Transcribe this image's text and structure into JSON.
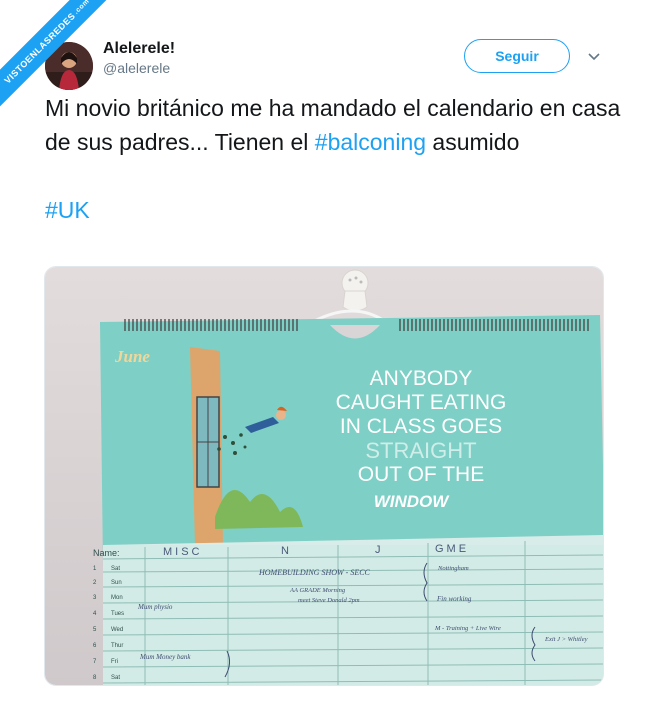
{
  "watermark": {
    "main": "VISTOENLASREDES",
    "suffix": ".com"
  },
  "author": {
    "display_name": "Alelerele!",
    "handle": "@alelerele"
  },
  "follow_label": "Seguir",
  "tweet": {
    "text_before": "Mi novio británico me ha mandado el calendario en casa de sus padres... Tienen el ",
    "hashtag1": "#balconing",
    "text_after": " asumido",
    "hashtag2": "#UK"
  },
  "photo": {
    "month": "June",
    "slogan_line1": "ANYBODY",
    "slogan_line2": "CAUGHT EATING",
    "slogan_line3": "IN CLASS GOES",
    "slogan_line4": "STRAIGHT",
    "slogan_line5": "OUT OF THE",
    "slogan_line6": "WINDOW",
    "names_label": "Name:",
    "columns": [
      "MISC",
      "N",
      "J",
      "GME"
    ],
    "rows": [
      {
        "num": "1",
        "day": "Sat"
      },
      {
        "num": "2",
        "day": "Sun"
      },
      {
        "num": "3",
        "day": "Mon"
      },
      {
        "num": "4",
        "day": "Tues"
      },
      {
        "num": "5",
        "day": "Wed"
      },
      {
        "num": "6",
        "day": "Thur"
      },
      {
        "num": "7",
        "day": "Fri"
      },
      {
        "num": "8",
        "day": "Sat"
      }
    ],
    "notes": {
      "homebuilding": "HOMEBUILDING SHOW - SECC",
      "aa_grade": "AA GRADE Morning",
      "meet": "meet Steve Donald 2pm",
      "nottingham": "Nottingham",
      "fin_working": "Fin working",
      "m_training": "M - Training + Live Wire",
      "exit": "Exit J > Whitley",
      "mum_physio": "Mum physio",
      "mum_money": "Mum Money bank"
    },
    "colors": {
      "teal": "#7ecfc6",
      "wall": "#d9d4d5",
      "orange": "#e8a060"
    }
  }
}
